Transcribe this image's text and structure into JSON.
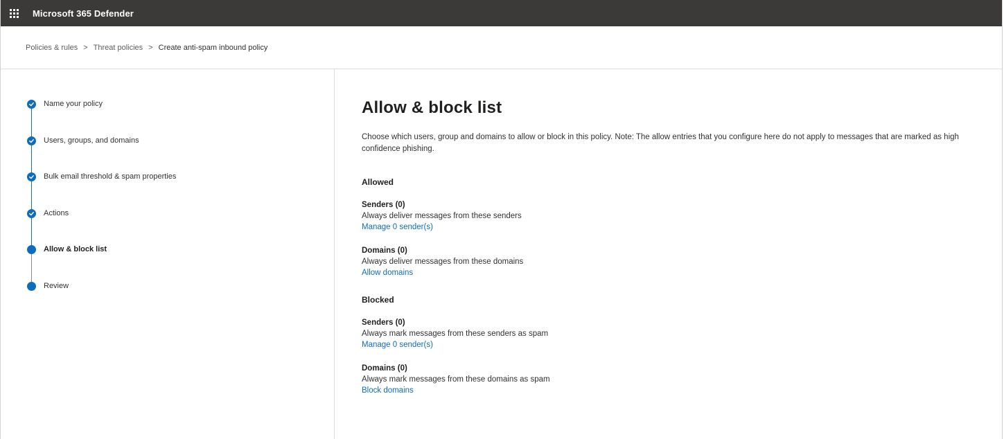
{
  "app": {
    "title": "Microsoft 365 Defender"
  },
  "breadcrumb": {
    "items": [
      "Policies & rules",
      "Threat policies"
    ],
    "current": "Create anti-spam inbound policy",
    "separator": ">"
  },
  "wizard": {
    "steps": [
      {
        "label": "Name your policy",
        "state": "completed"
      },
      {
        "label": "Users, groups, and domains",
        "state": "completed"
      },
      {
        "label": "Bulk email threshold & spam properties",
        "state": "completed"
      },
      {
        "label": "Actions",
        "state": "completed"
      },
      {
        "label": "Allow & block list",
        "state": "current"
      },
      {
        "label": "Review",
        "state": "pending"
      }
    ]
  },
  "main": {
    "title": "Allow & block list",
    "description": "Choose which users, group and domains to allow or block in this policy. Note: The allow entries that you configure here do not apply to messages that are marked as high confidence phishing.",
    "allowed": {
      "heading": "Allowed",
      "senders": {
        "title": "Senders (0)",
        "desc": "Always deliver messages from these senders",
        "link": "Manage 0 sender(s)"
      },
      "domains": {
        "title": "Domains (0)",
        "desc": "Always deliver messages from these domains",
        "link": "Allow domains"
      }
    },
    "blocked": {
      "heading": "Blocked",
      "senders": {
        "title": "Senders (0)",
        "desc": "Always mark messages from these senders as spam",
        "link": "Manage 0 sender(s)"
      },
      "domains": {
        "title": "Domains (0)",
        "desc": "Always mark messages from these domains as spam",
        "link": "Block domains"
      }
    }
  },
  "colors": {
    "topbar": "#3b3a39",
    "accent": "#0f6cbd",
    "pending_line": "#8a8886"
  },
  "icons": {
    "app_launcher": "waffle-icon",
    "completed_step": "checkmark-icon",
    "current_step": "filled-circle-icon"
  }
}
